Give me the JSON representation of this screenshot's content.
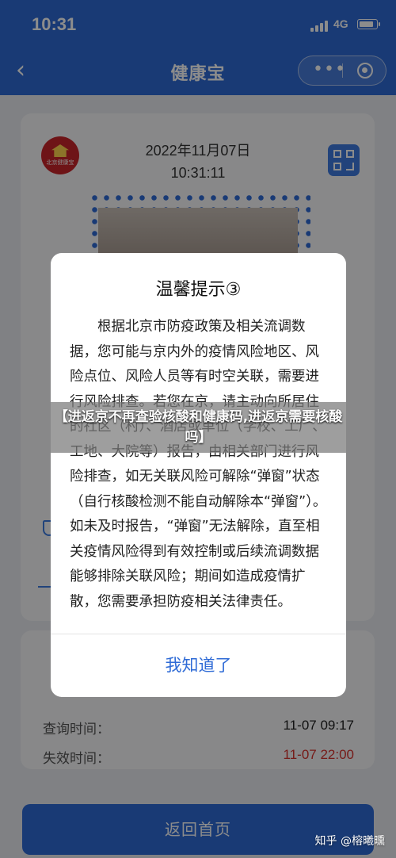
{
  "status_bar": {
    "time": "10:31",
    "network": "4G"
  },
  "header": {
    "title": "健康宝",
    "more_label": "•••"
  },
  "card": {
    "emblem_text": "北京健康宝",
    "date": "2022年11月07日",
    "time": "10:31:11"
  },
  "info_rows": [
    {
      "label": "查询时间：",
      "value": "11-07 09:17",
      "color": "#222222"
    },
    {
      "label": "失效时间：",
      "value": "11-07 22:00",
      "color": "#d8322d"
    }
  ],
  "home_button": "返回首页",
  "dialog": {
    "title": "温馨提示③",
    "body": "根据北京市防疫政策及相关流调数据，您可能与京内外的疫情风险地区、风险点位、风险人员等有时空关联，需要进行风险排查。若您在京，请主动向所居住的社区（村）、酒店或单位（学校、工厂、工地、大院等）报告，由相关部门进行风险排查，如无关联风险可解除“弹窗”状态（自行核酸检测不能自动解除本“弹窗”）。如未及时报告，“弹窗”无法解除，直至相关疫情风险得到有效控制或后续流调数据能够排除关联风险；期间如造成疫情扩散，您需要承担防疫相关法律责任。",
    "confirm": "我知道了"
  },
  "banner": "【进返京不再查验核酸和健康码,进返京需要核酸吗】",
  "watermark": "知乎 @榕曦曛"
}
